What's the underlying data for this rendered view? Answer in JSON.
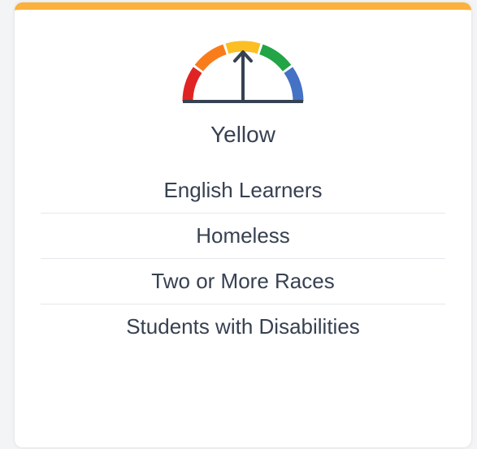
{
  "card": {
    "accent_color": "#fbb13c",
    "status_label": "Yellow",
    "gauge": {
      "icon": "speedometer-gauge-icon",
      "level": "Yellow",
      "segment_colors": [
        "#e02424",
        "#f97c1b",
        "#fbbf24",
        "#22a447",
        "#4472c4"
      ],
      "needle_color": "#374151"
    },
    "student_groups": [
      "English Learners",
      "Homeless",
      "Two or More Races",
      "Students with Disabilities"
    ]
  }
}
